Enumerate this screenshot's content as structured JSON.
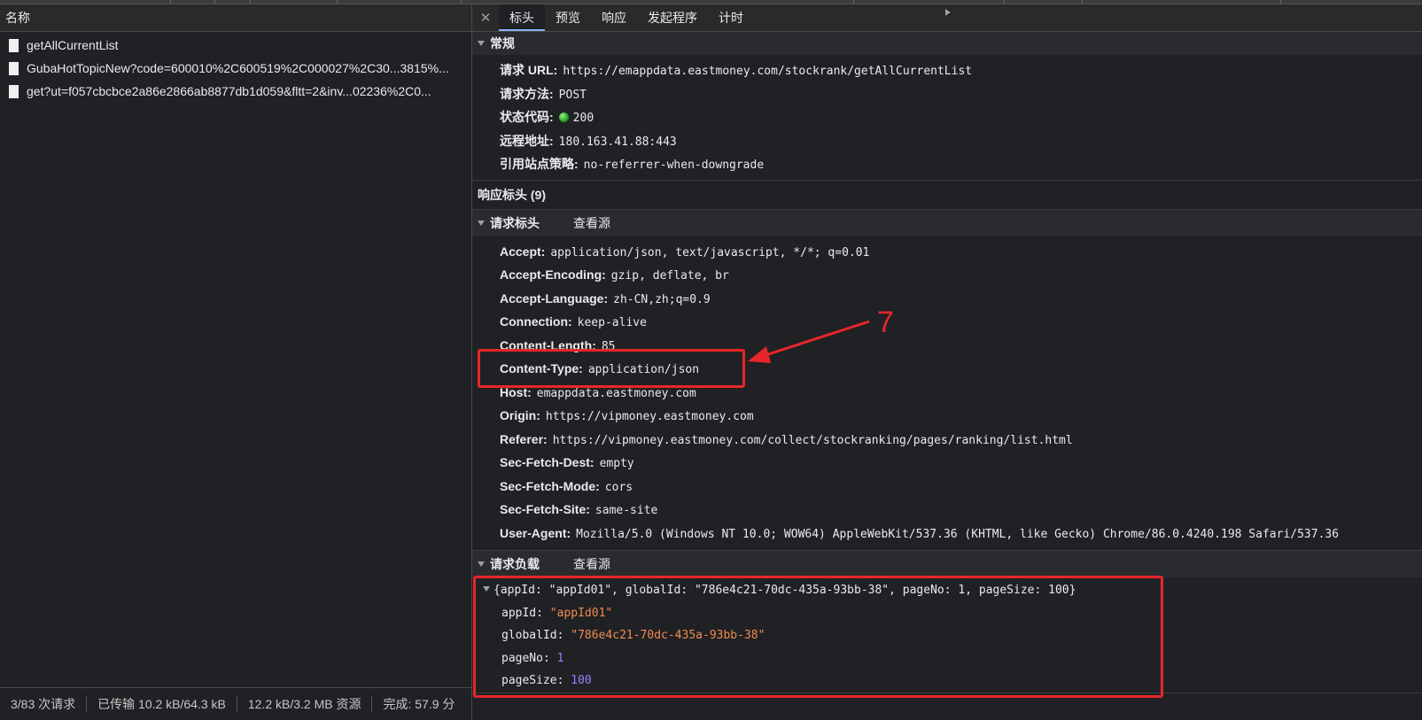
{
  "colors": {
    "annotation": "#e8262a",
    "string": "#f28b54",
    "number": "#9980ff",
    "status_ok": "#1fa51f"
  },
  "left": {
    "header": "名称",
    "requests": [
      "getAllCurrentList",
      "GubaHotTopicNew?code=600010%2C600519%2C000027%2C30...3815%...",
      "get?ut=f057cbcbce2a86e2866ab8877db1d059&fltt=2&inv...02236%2C0..."
    ],
    "status": {
      "requests": "3/83 次请求",
      "transferred": "已传输 10.2 kB/64.3 kB",
      "resources": "12.2 kB/3.2 MB 资源",
      "finish": "完成: 57.9 分"
    }
  },
  "right": {
    "close_icon": "close-icon",
    "tabs": [
      "标头",
      "预览",
      "响应",
      "发起程序",
      "计时"
    ],
    "general": {
      "title": "常规",
      "rows": [
        {
          "k": "请求 URL:",
          "v": "https://emappdata.eastmoney.com/stockrank/getAllCurrentList"
        },
        {
          "k": "请求方法:",
          "v": "POST"
        },
        {
          "k": "状态代码:",
          "v": "200"
        },
        {
          "k": "远程地址:",
          "v": "180.163.41.88:443"
        },
        {
          "k": "引用站点策略:",
          "v": "no-referrer-when-downgrade"
        }
      ]
    },
    "response_headers": {
      "title": "响应标头 (9)"
    },
    "request_headers": {
      "title": "请求标头",
      "view_source": "查看源",
      "rows": [
        {
          "k": "Accept:",
          "v": "application/json, text/javascript, */*; q=0.01"
        },
        {
          "k": "Accept-Encoding:",
          "v": "gzip, deflate, br"
        },
        {
          "k": "Accept-Language:",
          "v": "zh-CN,zh;q=0.9"
        },
        {
          "k": "Connection:",
          "v": "keep-alive"
        },
        {
          "k": "Content-Length:",
          "v": "85"
        },
        {
          "k": "Content-Type:",
          "v": "application/json"
        },
        {
          "k": "Host:",
          "v": "emappdata.eastmoney.com"
        },
        {
          "k": "Origin:",
          "v": "https://vipmoney.eastmoney.com"
        },
        {
          "k": "Referer:",
          "v": "https://vipmoney.eastmoney.com/collect/stockranking/pages/ranking/list.html"
        },
        {
          "k": "Sec-Fetch-Dest:",
          "v": "empty"
        },
        {
          "k": "Sec-Fetch-Mode:",
          "v": "cors"
        },
        {
          "k": "Sec-Fetch-Site:",
          "v": "same-site"
        },
        {
          "k": "User-Agent:",
          "v": "Mozilla/5.0 (Windows NT 10.0; WOW64) AppleWebKit/537.36 (KHTML, like Gecko) Chrome/86.0.4240.198 Safari/537.36"
        }
      ]
    },
    "payload": {
      "title": "请求负载",
      "view_source": "查看源",
      "summary": "{appId: \"appId01\", globalId: \"786e4c21-70dc-435a-93bb-38\", pageNo: 1, pageSize: 100}",
      "fields": [
        {
          "k": "appId:",
          "v": "\"appId01\"",
          "type": "str"
        },
        {
          "k": "globalId:",
          "v": "\"786e4c21-70dc-435a-93bb-38\"",
          "type": "str"
        },
        {
          "k": "pageNo:",
          "v": "1",
          "type": "num"
        },
        {
          "k": "pageSize:",
          "v": "100",
          "type": "num"
        }
      ]
    }
  },
  "annotation": {
    "number": "7"
  }
}
